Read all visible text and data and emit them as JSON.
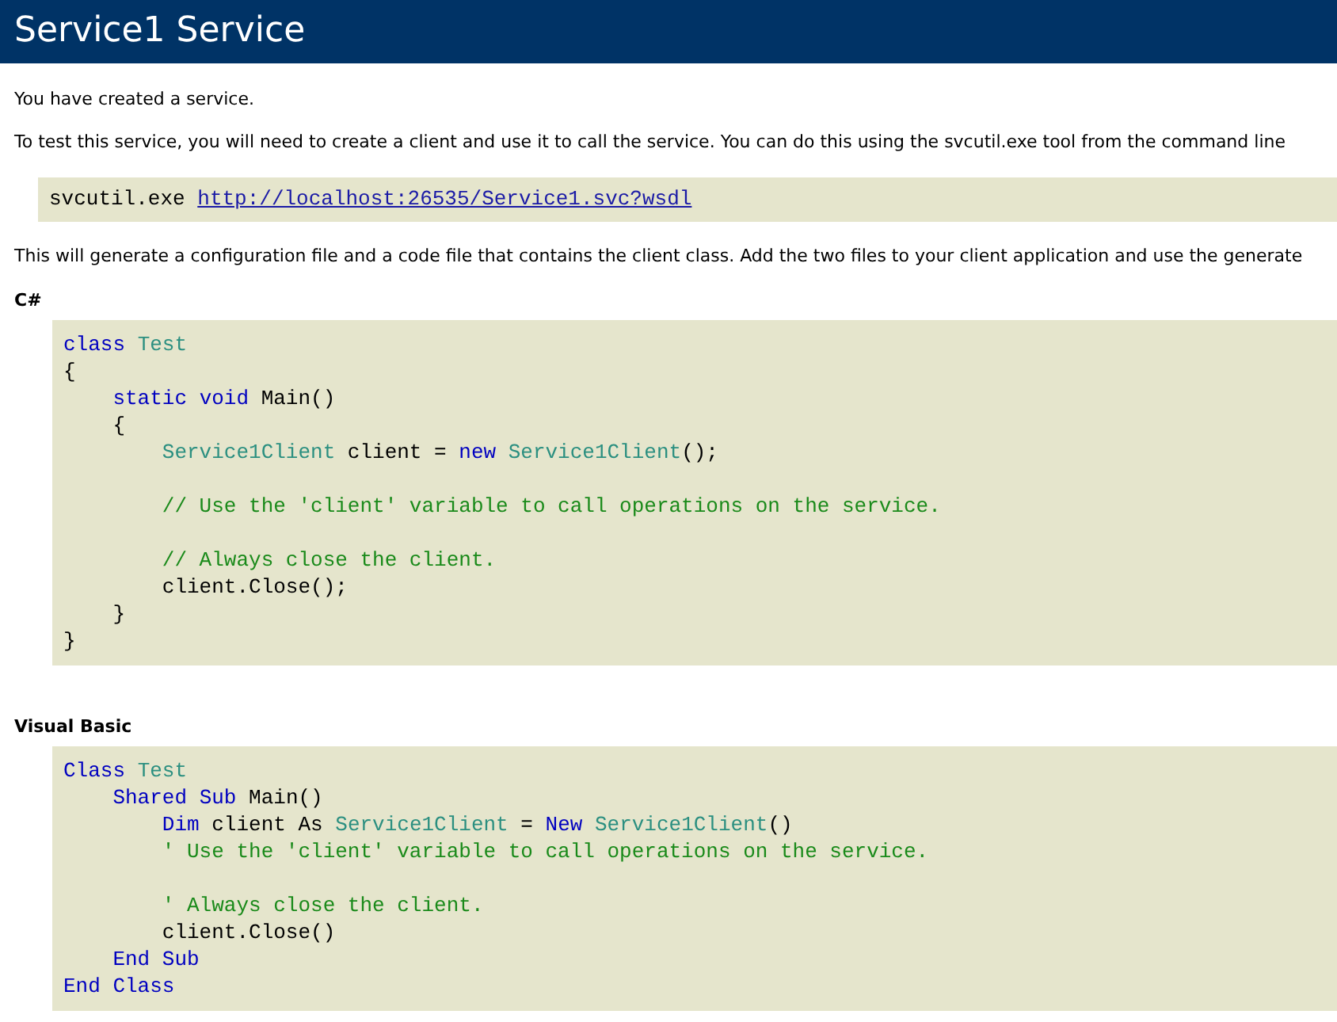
{
  "header": {
    "title": "Service1 Service"
  },
  "intro": [
    "You have created a service.",
    "To test this service, you will need to create a client and use it to call the service. You can do this using the svcutil.exe tool from the command line"
  ],
  "command": {
    "text": "svcutil.exe",
    "link": "http://localhost:26535/Service1.svc?wsdl"
  },
  "note": "This will generate a configuration file and a code file that contains the client class. Add the two files to your client application and use the generate",
  "samples": [
    {
      "heading": "C#",
      "lines": [
        {
          "kind": "line",
          "tokens": [
            {
              "kind": "keyword",
              "text": "class"
            },
            {
              "kind": "type",
              "text": " Test"
            }
          ]
        },
        {
          "kind": "line",
          "tokens": [
            {
              "kind": "plain",
              "text": "{"
            }
          ]
        },
        {
          "kind": "block",
          "children": [
            {
              "kind": "line",
              "tokens": [
                {
                  "kind": "keyword",
                  "text": "static"
                },
                {
                  "kind": "keyword",
                  "text": " void"
                },
                {
                  "kind": "plain",
                  "text": " Main()"
                }
              ]
            },
            {
              "kind": "line",
              "tokens": [
                {
                  "kind": "plain",
                  "text": "{"
                }
              ]
            },
            {
              "kind": "block",
              "children": [
                {
                  "kind": "line",
                  "tokens": [
                    {
                      "kind": "type",
                      "text": "Service1Client"
                    },
                    {
                      "kind": "plain",
                      "text": " client = "
                    },
                    {
                      "kind": "keyword",
                      "text": "new"
                    },
                    {
                      "kind": "type",
                      "text": " Service1Client"
                    },
                    {
                      "kind": "plain",
                      "text": "();"
                    }
                  ]
                },
                {
                  "kind": "blank"
                },
                {
                  "kind": "line",
                  "tokens": [
                    {
                      "kind": "comment",
                      "text": "// Use the 'client' variable to call operations on the service."
                    }
                  ]
                },
                {
                  "kind": "blank"
                },
                {
                  "kind": "line",
                  "tokens": [
                    {
                      "kind": "comment",
                      "text": "// Always close the client."
                    }
                  ]
                },
                {
                  "kind": "line",
                  "tokens": [
                    {
                      "kind": "plain",
                      "text": "client.Close();"
                    }
                  ]
                }
              ]
            },
            {
              "kind": "line",
              "tokens": [
                {
                  "kind": "plain",
                  "text": "}"
                }
              ]
            }
          ]
        },
        {
          "kind": "line",
          "tokens": [
            {
              "kind": "plain",
              "text": "}"
            }
          ]
        }
      ]
    },
    {
      "heading": "Visual Basic",
      "lines": [
        {
          "kind": "line",
          "tokens": [
            {
              "kind": "keyword",
              "text": "Class"
            },
            {
              "kind": "type",
              "text": " Test"
            }
          ]
        },
        {
          "kind": "block",
          "children": [
            {
              "kind": "line",
              "tokens": [
                {
                  "kind": "keyword",
                  "text": "Shared"
                },
                {
                  "kind": "keyword",
                  "text": " Sub"
                },
                {
                  "kind": "plain",
                  "text": " Main()"
                }
              ]
            },
            {
              "kind": "block",
              "children": [
                {
                  "kind": "line",
                  "tokens": [
                    {
                      "kind": "keyword",
                      "text": "Dim"
                    },
                    {
                      "kind": "plain",
                      "text": " client As "
                    },
                    {
                      "kind": "type",
                      "text": "Service1Client"
                    },
                    {
                      "kind": "plain",
                      "text": " = "
                    },
                    {
                      "kind": "keyword",
                      "text": "New"
                    },
                    {
                      "kind": "type",
                      "text": " Service1Client"
                    },
                    {
                      "kind": "plain",
                      "text": "()"
                    }
                  ]
                },
                {
                  "kind": "line",
                  "tokens": [
                    {
                      "kind": "comment",
                      "text": "' Use the 'client' variable to call operations on the service."
                    }
                  ]
                },
                {
                  "kind": "blank"
                },
                {
                  "kind": "line",
                  "tokens": [
                    {
                      "kind": "comment",
                      "text": "' Always close the client."
                    }
                  ]
                },
                {
                  "kind": "line",
                  "tokens": [
                    {
                      "kind": "plain",
                      "text": "client.Close()"
                    }
                  ]
                }
              ]
            },
            {
              "kind": "line",
              "tokens": [
                {
                  "kind": "keyword",
                  "text": "End"
                },
                {
                  "kind": "keyword",
                  "text": " Sub"
                }
              ]
            }
          ]
        },
        {
          "kind": "line",
          "tokens": [
            {
              "kind": "keyword",
              "text": "End"
            },
            {
              "kind": "keyword",
              "text": " Class"
            }
          ]
        }
      ]
    }
  ]
}
